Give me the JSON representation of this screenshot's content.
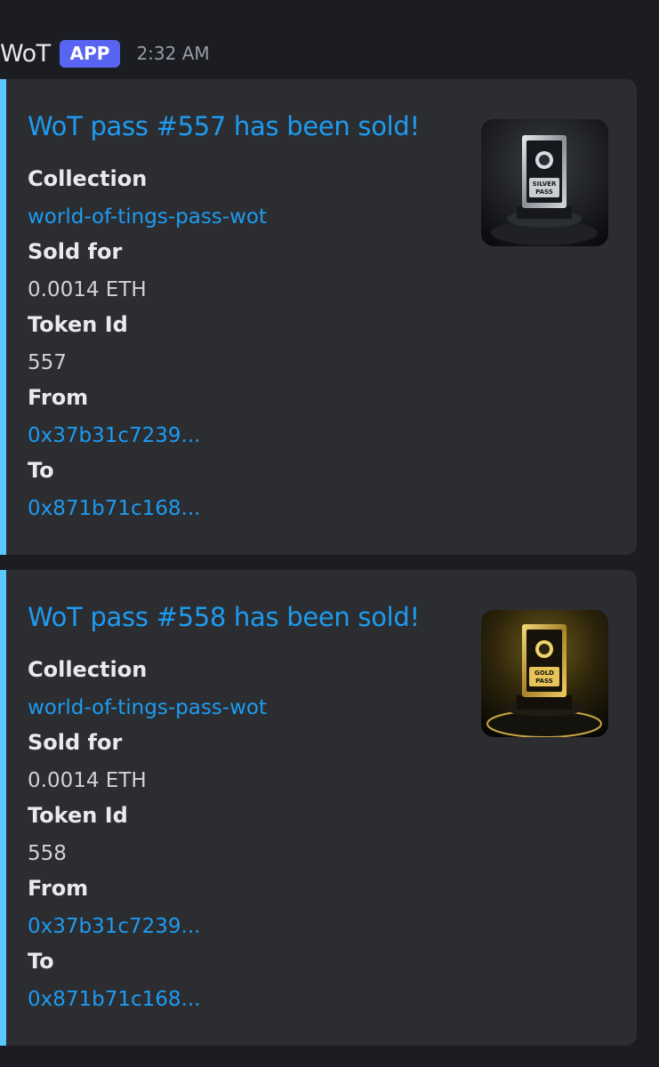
{
  "message": {
    "author": "WoT",
    "badge": "APP",
    "timestamp": "2:32 AM"
  },
  "embeds": [
    {
      "title": "WoT pass #557 has been sold!",
      "accent_color": "#5ac8fa",
      "thumbnail": {
        "kind": "silver-pass",
        "label_top": "SILVER",
        "label_bottom": "PASS"
      },
      "fields": [
        {
          "name": "Collection",
          "value": "world-of-tings-pass-wot"
        },
        {
          "name": "Sold for",
          "value": "0.0014 ETH"
        },
        {
          "name": "Token Id",
          "value": "557"
        },
        {
          "name": "From",
          "value": "0x37b31c7239..."
        },
        {
          "name": "To",
          "value": "0x871b71c168..."
        }
      ]
    },
    {
      "title": "WoT pass #558 has been sold!",
      "accent_color": "#5ac8fa",
      "thumbnail": {
        "kind": "gold-pass",
        "label_top": "GOLD",
        "label_bottom": "PASS"
      },
      "fields": [
        {
          "name": "Collection",
          "value": "world-of-tings-pass-wot"
        },
        {
          "name": "Sold for",
          "value": "0.0014 ETH"
        },
        {
          "name": "Token Id",
          "value": "558"
        },
        {
          "name": "From",
          "value": "0x37b31c7239..."
        },
        {
          "name": "To",
          "value": "0x871b71c168..."
        }
      ]
    }
  ]
}
